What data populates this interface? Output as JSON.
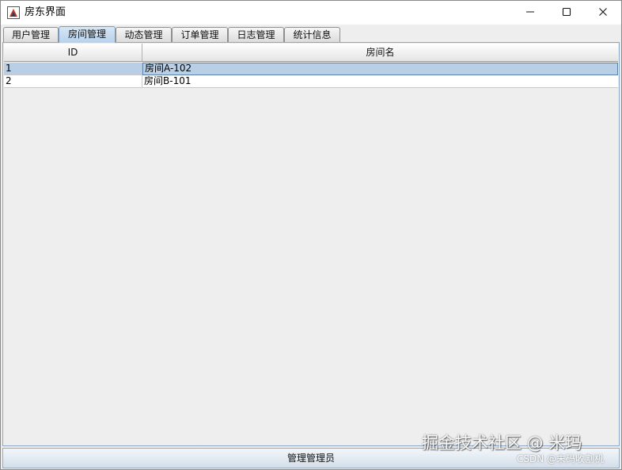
{
  "window": {
    "title": "房东界面",
    "icon": "java-app-icon",
    "controls": {
      "minimize": "minimize-icon",
      "maximize": "maximize-icon",
      "close": "close-icon"
    }
  },
  "tabs": [
    {
      "label": "用户管理"
    },
    {
      "label": "房间管理"
    },
    {
      "label": "动态管理"
    },
    {
      "label": "订单管理"
    },
    {
      "label": "日志管理"
    },
    {
      "label": "统计信息"
    }
  ],
  "active_tab": "房间管理",
  "table": {
    "columns": [
      "ID",
      "房间名"
    ],
    "rows": [
      [
        "1",
        "房间A-102"
      ],
      [
        "2",
        "房间B-101"
      ]
    ],
    "selected_row": 1
  },
  "statusbar": {
    "text": "管理管理员"
  },
  "watermark": {
    "main": "掘金技术社区 @ 米玛",
    "sub": "CSDN @末码收割机"
  },
  "colors": {
    "selection": "#b8cfe5",
    "active_tab": "#b8d2ec",
    "border": "#8ba7c6"
  }
}
